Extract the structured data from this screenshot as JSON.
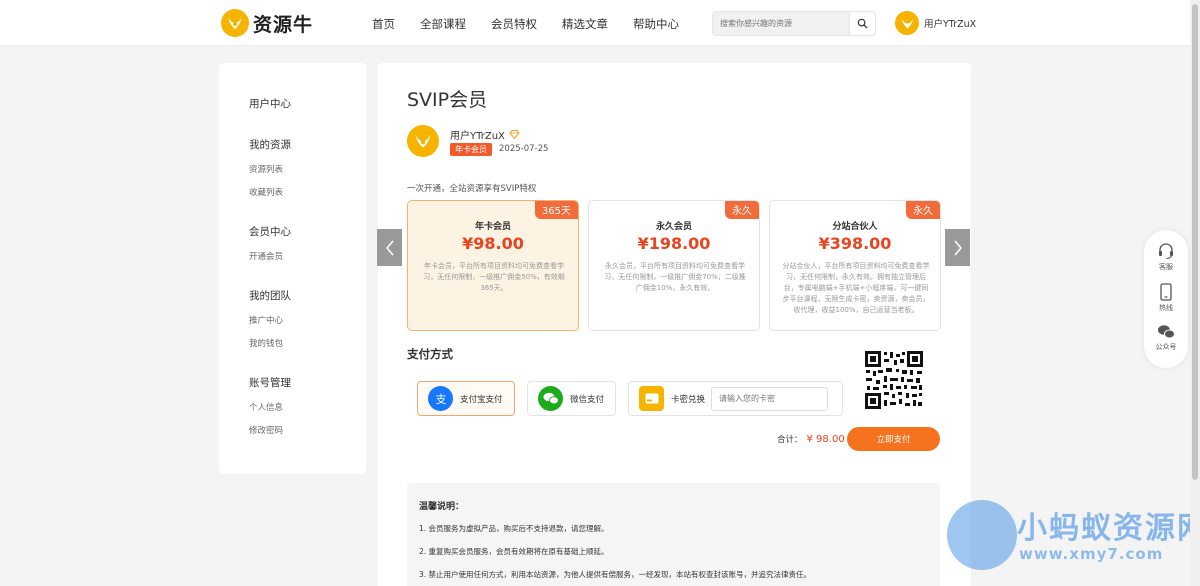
{
  "header": {
    "logo_text": "资源牛",
    "nav": [
      "首页",
      "全部课程",
      "会员特权",
      "精选文章",
      "帮助中心"
    ],
    "search_placeholder": "搜索你感兴趣的资源",
    "username": "用户YTrZuX"
  },
  "sidebar": {
    "user_center": "用户中心",
    "groups": [
      {
        "title": "我的资源",
        "items": [
          "资源列表",
          "收藏列表"
        ]
      },
      {
        "title": "会员中心",
        "items": [
          "开通会员"
        ]
      },
      {
        "title": "我的团队",
        "items": [
          "推广中心",
          "我的钱包"
        ]
      },
      {
        "title": "账号管理",
        "items": [
          "个人信息",
          "修改密码"
        ]
      }
    ]
  },
  "main": {
    "title": "SVIP会员",
    "user": {
      "name": "用户YTrZuX",
      "badge": "年卡会员",
      "date": "2025-07-25"
    },
    "description": "一次开通，全站资源享有SVIP特权",
    "plans": [
      {
        "tag": "365天",
        "name": "年卡会员",
        "price": "¥98.00",
        "desc": "年卡会员，平台所有项目资料均可免费查看学习，无任何限制，一级推广佣金50%，有效期365天。"
      },
      {
        "tag": "永久",
        "name": "永久会员",
        "price": "¥198.00",
        "desc": "永久会员，平台所有项目资料均可免费查看学习，无任何限制，一级推广佣金70%，二级推广佣金10%，永久有效。"
      },
      {
        "tag": "永久",
        "name": "分站合伙人",
        "price": "¥398.00",
        "desc": "分站合伙人，平台所有项目资料均可免费查看学习，无任何限制，永久有效。拥有独立管理后台，专属电脑端+手机端+小程序端，可一键同步平台课程，无限生成卡密，卖资源，卖会员，收代理，收益100%，自己运营当老板。"
      }
    ],
    "payment": {
      "title": "支付方式",
      "alipay": "支付宝支付",
      "wechat": "微信支付",
      "card": "卡密兑换",
      "card_placeholder": "请输入您的卡密",
      "total_label": "合计：",
      "total_amount": "¥ 98.00",
      "pay_button": "立即支付"
    },
    "notice": {
      "title": "温馨说明：",
      "items": [
        "1. 会员服务为虚拟产品，购买后不支持退款，请您理解。",
        "2. 重复购买会员服务，会员有效期将在原有基础上顺延。",
        "3. 禁止用户使用任何方式，利用本站资源，为他人提供有偿服务，一经发现，本站有权查封该账号，并追究法律责任。"
      ]
    }
  },
  "float_bar": [
    "客服",
    "热线",
    "公众号"
  ],
  "watermark": {
    "text": "小蚂蚁资源网",
    "url": "www.xmy7.com"
  },
  "colors": {
    "brand": "#f6b400",
    "accent": "#f5721f",
    "price": "#e8441f"
  }
}
